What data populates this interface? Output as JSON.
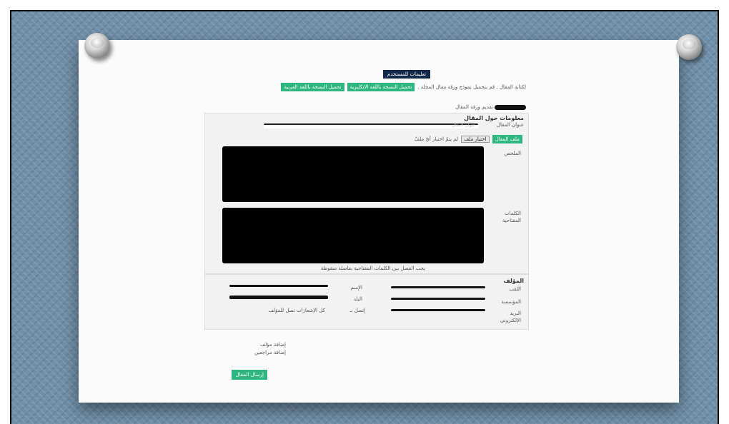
{
  "header": {
    "guide_button": "تعليمات للمستخدم",
    "intro_text": "لكتابة المقال , قم بتحميل نموذج ورقة مقال المجلة .",
    "download_english": "تحميل النسخة باللغة الانكليزية",
    "download_arabic": "تحميل النسخة باللغة العربية",
    "submit_label": "تقديم ورقة المقال"
  },
  "article": {
    "section_title": "معلومات حول المقال",
    "title_label": "عنوان المقال",
    "title_placeholder": "عنوان المقال",
    "file_label": "ملف المقال",
    "choose_file": "اختيار ملف",
    "no_file": "لم يتمّ اختيار أيّ ملفّ",
    "abstract_label": "الملخص",
    "keywords_label_1": "الكلمات",
    "keywords_label_2": "المفتاحية",
    "keywords_hint": "يجب الفصل بين الكلمات المفتاحية بفاصلة منقوطة"
  },
  "author": {
    "section_title": "المؤلف",
    "title_label": "اللقب",
    "institution_label": "المؤسسة",
    "email_label_1": "البريد",
    "email_label_2": "الإلكتروني",
    "name_label": "الإسم",
    "country_label": "البلد",
    "contact_label": "إتصل بـ",
    "notify_text": "كل الإشعارات تصل للمؤلف"
  },
  "actions": {
    "add_author": "إضافة مؤلف",
    "add_reviewers": "إضافة مراجعين",
    "send_article": "إرسال المقال"
  },
  "colors": {
    "navy": "#12294a",
    "green": "#2db77f",
    "background": "#6f8ea8"
  }
}
